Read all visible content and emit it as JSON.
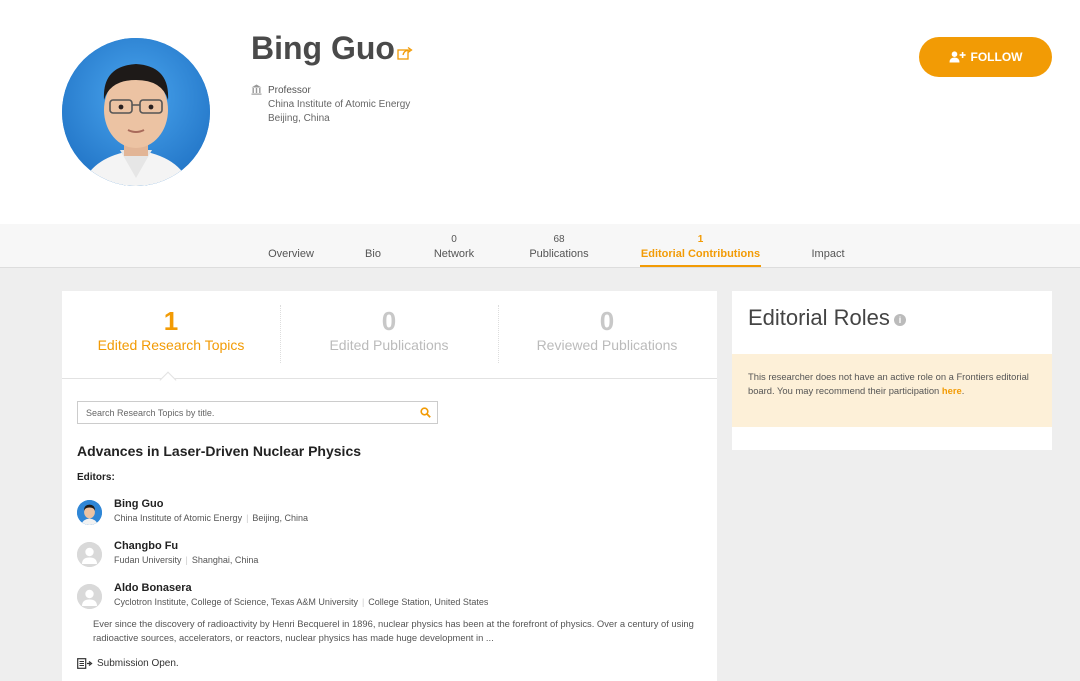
{
  "profile": {
    "name": "Bing Guo",
    "title": "Professor",
    "institution": "China Institute of Atomic Energy",
    "location": "Beijing, China",
    "follow_label": "FOLLOW"
  },
  "nav": {
    "tabs": [
      {
        "count": "",
        "label": "Overview"
      },
      {
        "count": "",
        "label": "Bio"
      },
      {
        "count": "0",
        "label": "Network"
      },
      {
        "count": "68",
        "label": "Publications"
      },
      {
        "count": "1",
        "label": "Editorial Contributions"
      },
      {
        "count": "",
        "label": "Impact"
      }
    ]
  },
  "stats": [
    {
      "value": "1",
      "label": "Edited Research Topics"
    },
    {
      "value": "0",
      "label": "Edited Publications"
    },
    {
      "value": "0",
      "label": "Reviewed Publications"
    }
  ],
  "search": {
    "placeholder": "Search Research Topics by title."
  },
  "topic": {
    "title": "Advances in Laser-Driven Nuclear Physics",
    "editors_label": "Editors:",
    "editors": [
      {
        "name": "Bing Guo",
        "institution": "China Institute of Atomic Energy",
        "location": "Beijing, China"
      },
      {
        "name": "Changbo Fu",
        "institution": "Fudan University",
        "location": "Shanghai, China"
      },
      {
        "name": "Aldo Bonasera",
        "institution": "Cyclotron Institute, College of Science, Texas A&M University",
        "location": "College Station, United States"
      }
    ],
    "description": "Ever since the discovery of radioactivity by Henri Becquerel in 1896, nuclear physics has been at the forefront of physics. Over a century of using radioactive sources, accelerators, or reactors, nuclear physics has made huge development in ...",
    "submission": "Submission Open."
  },
  "editorial_roles": {
    "title": "Editorial Roles",
    "notice": "This researcher does not have an active role on a Frontiers editorial board. You may recommend their participation",
    "link": "here",
    "period": "."
  },
  "colors": {
    "accent": "#f29b05",
    "notice_bg": "#fdf0d8",
    "page_bg": "#eeeeee"
  }
}
